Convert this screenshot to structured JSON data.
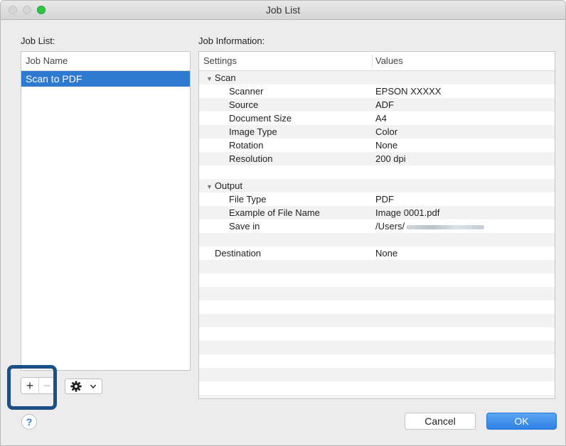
{
  "window": {
    "title": "Job List"
  },
  "job_list": {
    "label": "Job List:",
    "column_header": "Job Name",
    "items": [
      "Scan to PDF"
    ],
    "selected_index": 0
  },
  "job_info": {
    "label": "Job Information:",
    "columns": {
      "settings": "Settings",
      "values": "Values"
    },
    "rows": [
      {
        "type": "group",
        "key": "Scan",
        "value": ""
      },
      {
        "type": "item",
        "key": "Scanner",
        "value": "EPSON XXXXX"
      },
      {
        "type": "item",
        "key": "Source",
        "value": "ADF"
      },
      {
        "type": "item",
        "key": "Document Size",
        "value": "A4"
      },
      {
        "type": "item",
        "key": "Image Type",
        "value": "Color"
      },
      {
        "type": "item",
        "key": "Rotation",
        "value": "None"
      },
      {
        "type": "item",
        "key": "Resolution",
        "value": "200 dpi"
      },
      {
        "type": "blank",
        "key": "",
        "value": ""
      },
      {
        "type": "group",
        "key": "Output",
        "value": ""
      },
      {
        "type": "item",
        "key": "File Type",
        "value": "PDF"
      },
      {
        "type": "item",
        "key": "Example of File Name",
        "value": "Image 0001.pdf"
      },
      {
        "type": "item",
        "key": "Save in",
        "value": "/Users/",
        "blurred": true
      },
      {
        "type": "blank",
        "key": "",
        "value": ""
      },
      {
        "type": "top",
        "key": "Destination",
        "value": "None"
      },
      {
        "type": "blank",
        "key": "",
        "value": ""
      },
      {
        "type": "blank",
        "key": "",
        "value": ""
      },
      {
        "type": "blank",
        "key": "",
        "value": ""
      },
      {
        "type": "blank",
        "key": "",
        "value": ""
      },
      {
        "type": "blank",
        "key": "",
        "value": ""
      },
      {
        "type": "blank",
        "key": "",
        "value": ""
      },
      {
        "type": "blank",
        "key": "",
        "value": ""
      },
      {
        "type": "blank",
        "key": "",
        "value": ""
      },
      {
        "type": "blank",
        "key": "",
        "value": ""
      },
      {
        "type": "blank",
        "key": "",
        "value": ""
      },
      {
        "type": "blank",
        "key": "",
        "value": ""
      }
    ]
  },
  "controls": {
    "add_label": "+",
    "remove_label": "−",
    "help_label": "?",
    "cancel_label": "Cancel",
    "ok_label": "OK"
  },
  "colors": {
    "selection": "#2f7ad1",
    "highlight": "#1b4f87",
    "ok": "#2d81e4"
  }
}
